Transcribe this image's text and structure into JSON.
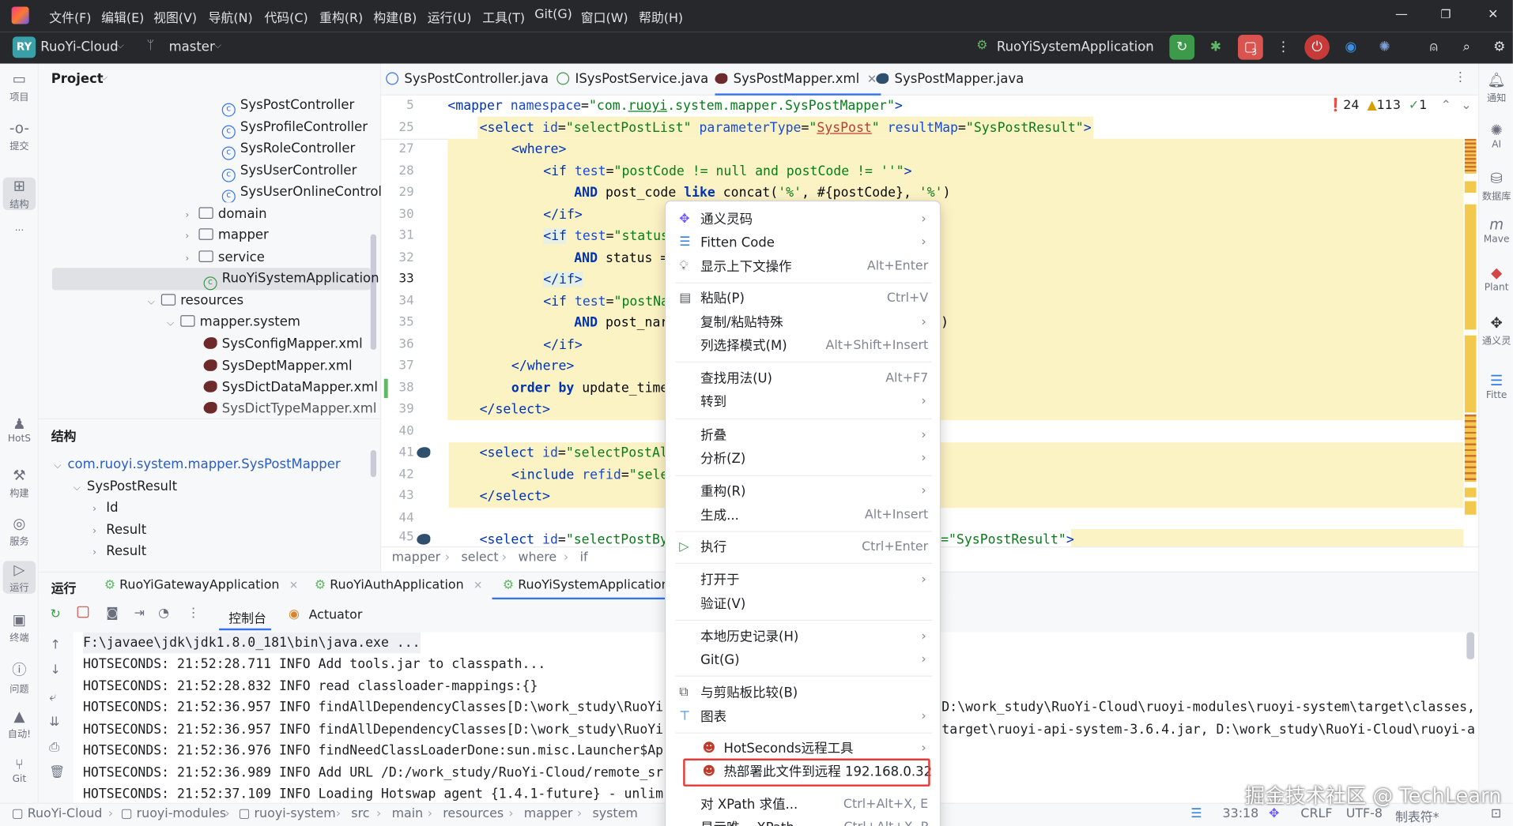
{
  "menu_bar": {
    "items": [
      "文件(F)",
      "编辑(E)",
      "视图(V)",
      "导航(N)",
      "代码(C)",
      "重构(R)",
      "构建(B)",
      "运行(U)",
      "工具(T)",
      "Git(G)",
      "窗口(W)",
      "帮助(H)"
    ],
    "window_controls": [
      "—",
      "❐",
      "✕"
    ]
  },
  "toolbar": {
    "project_badge": "RY",
    "project_name": "RuoYi-Cloud",
    "branch": "master",
    "run_config": "RuoYiSystemApplication",
    "badge_count": "3"
  },
  "left_strip": [
    "项目",
    "提交",
    "结构",
    "···",
    "HotS",
    "构建",
    "服务",
    "运行",
    "终端",
    "问题",
    "自动!",
    "Git"
  ],
  "project": {
    "title": "Project",
    "tree": [
      {
        "label": "SysPostController",
        "kind": "class"
      },
      {
        "label": "SysProfileController",
        "kind": "class"
      },
      {
        "label": "SysRoleController",
        "kind": "class"
      },
      {
        "label": "SysUserController",
        "kind": "class"
      },
      {
        "label": "SysUserOnlineControlle",
        "kind": "class"
      },
      {
        "label": "domain",
        "kind": "folder"
      },
      {
        "label": "mapper",
        "kind": "folder"
      },
      {
        "label": "service",
        "kind": "folder"
      },
      {
        "label": "RuoYiSystemApplication",
        "kind": "app"
      },
      {
        "label": "resources",
        "kind": "folder"
      },
      {
        "label": "mapper.system",
        "kind": "folder"
      },
      {
        "label": "SysConfigMapper.xml",
        "kind": "xml"
      },
      {
        "label": "SysDeptMapper.xml",
        "kind": "xml"
      },
      {
        "label": "SysDictDataMapper.xml",
        "kind": "xml"
      },
      {
        "label": "SysDictTypeMapper.xml",
        "kind": "xml"
      }
    ],
    "structure_title": "结构",
    "structure": [
      "com.ruoyi.system.mapper.SysPostMapper",
      "SysPostResult",
      "Id",
      "Result",
      "Result"
    ]
  },
  "editor": {
    "tabs": [
      "SysPostController.java",
      "ISysPostService.java",
      "SysPostMapper.xml",
      "SysPostMapper.java"
    ],
    "inspections": {
      "errors": "24",
      "warnings": "113",
      "ok": "1"
    },
    "line_numbers": [
      "5",
      "25",
      "27",
      "28",
      "29",
      "30",
      "31",
      "32",
      "33",
      "34",
      "35",
      "36",
      "37",
      "38",
      "39",
      "40",
      "41",
      "42",
      "43",
      "44",
      "45"
    ],
    "breadcrumb": [
      "mapper",
      "select",
      "where",
      "if"
    ]
  },
  "context_menu": {
    "items": [
      {
        "label": "通义灵码",
        "shortcut": "",
        "sub": true
      },
      {
        "label": "Fitten Code",
        "shortcut": "",
        "sub": true
      },
      {
        "label": "显示上下文操作",
        "shortcut": "Alt+Enter",
        "sub": false
      },
      {
        "label": "粘贴(P)",
        "shortcut": "Ctrl+V",
        "sub": false
      },
      {
        "label": "复制/粘贴特殊",
        "shortcut": "",
        "sub": true
      },
      {
        "label": "列选择模式(M)",
        "shortcut": "Alt+Shift+Insert",
        "sub": false
      },
      {
        "label": "查找用法(U)",
        "shortcut": "Alt+F7",
        "sub": false
      },
      {
        "label": "转到",
        "shortcut": "",
        "sub": true
      },
      {
        "label": "折叠",
        "shortcut": "",
        "sub": true
      },
      {
        "label": "分析(Z)",
        "shortcut": "",
        "sub": true
      },
      {
        "label": "重构(R)",
        "shortcut": "",
        "sub": true
      },
      {
        "label": "生成...",
        "shortcut": "Alt+Insert",
        "sub": false
      },
      {
        "label": "执行",
        "shortcut": "Ctrl+Enter",
        "sub": false
      },
      {
        "label": "打开于",
        "shortcut": "",
        "sub": true
      },
      {
        "label": "验证(V)",
        "shortcut": "",
        "sub": false
      },
      {
        "label": "本地历史记录(H)",
        "shortcut": "",
        "sub": true
      },
      {
        "label": "Git(G)",
        "shortcut": "",
        "sub": true
      },
      {
        "label": "与剪贴板比较(B)",
        "shortcut": "",
        "sub": false
      },
      {
        "label": "图表",
        "shortcut": "",
        "sub": true
      },
      {
        "label": "HotSeconds远程工具",
        "shortcut": "",
        "sub": true
      },
      {
        "label": "热部署此文件到远程 192.168.0.32",
        "shortcut": "",
        "sub": false
      },
      {
        "label": "对 XPath 求值...",
        "shortcut": "Ctrl+Alt+X, E",
        "sub": false
      },
      {
        "label": "显示唯一 XPath",
        "shortcut": "Ctrl+Alt+X, P",
        "sub": false
      }
    ]
  },
  "run_panel": {
    "title": "运行",
    "tabs": [
      "RuoYiGatewayApplication",
      "RuoYiAuthApplication",
      "RuoYiSystemApplication"
    ],
    "subtabs": [
      "控制台",
      "Actuator"
    ],
    "console": [
      "F:\\javaee\\jdk\\jdk1.8.0_181\\bin\\java.exe ...",
      "HOTSECONDS: 21:52:28.711 INFO Add tools.jar to classpath...",
      "HOTSECONDS: 21:52:28.832 INFO read classloader-mappings:{}",
      "HOTSECONDS: 21:52:36.957 INFO findAllDependencyClasses[D:\\work_study\\RuoYi",
      "HOTSECONDS: 21:52:36.957 INFO findAllDependencyClasses[D:\\work_study\\RuoYi",
      "HOTSECONDS: 21:52:36.976 INFO findNeedClassLoaderDone:sun.misc.Launcher$Ap",
      "HOTSECONDS: 21:52:36.989 INFO Add URL /D:/work_study/RuoYi-Cloud/remote_sr",
      "HOTSECONDS: 21:52:37.109 INFO Loading Hotswap agent {1.4.1-future} - unlim"
    ],
    "console_tail": [
      "D:\\work_study\\RuoYi-Cloud\\ruoyi-modules\\ruoyi-system\\target\\classes,",
      "target\\ruoyi-api-system-3.6.4.jar, D:\\work_study\\RuoYi-Cloud\\ruoyi-a"
    ]
  },
  "status_bar": {
    "path": [
      "RuoYi-Cloud",
      "ruoyi-modules",
      "ruoyi-system",
      "src",
      "main",
      "resources",
      "mapper",
      "system"
    ],
    "position": "33:18",
    "line_sep": "CRLF",
    "encoding": "UTF-8",
    "indent": "制表符*"
  },
  "right_strip": [
    "通知",
    "AI",
    "数据库",
    "Mave",
    "Plant",
    "通义灵",
    "Fitte"
  ],
  "watermark": "掘金技术社区 @ TechLearn"
}
